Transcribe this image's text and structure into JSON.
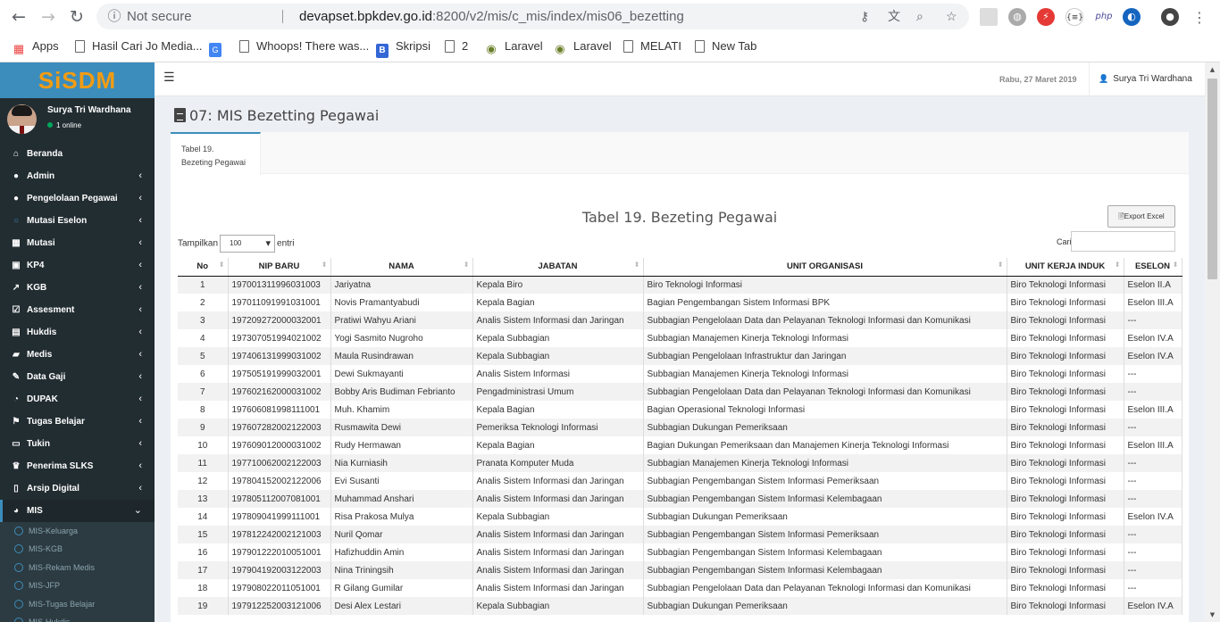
{
  "browser": {
    "security_label": "Not secure",
    "url_host": "devapset.bpkdev.go.id",
    "url_rest": ":8200/v2/mis/c_mis/index/mis06_bezetting",
    "bookmarks": [
      {
        "label": "Apps",
        "icon": "apps-grid-icon"
      },
      {
        "label": "Hasil Cari Jo Media...",
        "icon": "page-icon"
      },
      {
        "label": "",
        "icon": "translate-icon"
      },
      {
        "label": "Whoops! There was...",
        "icon": "page-icon"
      },
      {
        "label": "Skripsi",
        "icon": "b-blue-icon"
      },
      {
        "label": "2",
        "icon": "page-icon"
      },
      {
        "label": "Laravel",
        "icon": "globe-icon"
      },
      {
        "label": "Laravel",
        "icon": "globe-icon"
      },
      {
        "label": "MELATI",
        "icon": "page-icon"
      },
      {
        "label": "New Tab",
        "icon": "page-icon"
      }
    ],
    "ext_php_label": "php"
  },
  "sidebar": {
    "logo": "SiSDM",
    "user_name": "Surya Tri Wardhana",
    "user_status": "1 online",
    "items": [
      {
        "label": "Beranda",
        "icon": "home-icon",
        "chevron": false
      },
      {
        "label": "Admin",
        "icon": "circle-icon",
        "chevron": true
      },
      {
        "label": "Pengelolaan Pegawai",
        "icon": "circle-icon",
        "chevron": true
      },
      {
        "label": "Mutasi Eselon",
        "icon": "circle-outline-icon",
        "chevron": true
      },
      {
        "label": "Mutasi",
        "icon": "grid-icon",
        "chevron": true
      },
      {
        "label": "KP4",
        "icon": "id-card-icon",
        "chevron": true
      },
      {
        "label": "KGB",
        "icon": "line-chart-icon",
        "chevron": true
      },
      {
        "label": "Assesment",
        "icon": "check-square-icon",
        "chevron": true
      },
      {
        "label": "Hukdis",
        "icon": "book-icon",
        "chevron": true
      },
      {
        "label": "Medis",
        "icon": "ambulance-icon",
        "chevron": true
      },
      {
        "label": "Data Gaji",
        "icon": "edit-icon",
        "chevron": true
      },
      {
        "label": "DUPAK",
        "icon": "dashboard-icon",
        "chevron": true
      },
      {
        "label": "Tugas Belajar",
        "icon": "flag-icon",
        "chevron": true
      },
      {
        "label": "Tukin",
        "icon": "money-icon",
        "chevron": true
      },
      {
        "label": "Penerima SLKS",
        "icon": "trophy-icon",
        "chevron": true
      },
      {
        "label": "Arsip Digital",
        "icon": "file-icon",
        "chevron": true
      },
      {
        "label": "MIS",
        "icon": "pie-chart-icon",
        "chevron": true
      }
    ],
    "mis_subitems": [
      "MIS-Keluarga",
      "MIS-KGB",
      "MIS-Rekam Medis",
      "MIS-JFP",
      "MIS-Tugas Belajar",
      "MIS-Hukdis"
    ]
  },
  "topbar": {
    "date": "Rabu, 27 Maret 2019",
    "user": "Surya Tri Wardhana"
  },
  "page": {
    "title": "07: MIS Bezetting Pegawai",
    "tab_line1": "Tabel 19.",
    "tab_line2": "Bezeting Pegawai",
    "table_title": "Tabel 19. Bezeting Pegawai",
    "export_label": "Export Excel",
    "length_prefix": "Tampilkan",
    "length_value": "100",
    "length_suffix": "entri",
    "search_label": "Cari:"
  },
  "table": {
    "columns": [
      "No",
      "NIP BARU",
      "NAMA",
      "JABATAN",
      "UNIT ORGANISASI",
      "UNIT KERJA INDUK",
      "ESELON"
    ],
    "rows": [
      [
        "1",
        "197001311996031003",
        "Jariyatna",
        "Kepala Biro",
        "Biro Teknologi Informasi",
        "Biro Teknologi Informasi",
        "Eselon II.A"
      ],
      [
        "2",
        "197011091991031001",
        "Novis Pramantyabudi",
        "Kepala Bagian",
        "Bagian Pengembangan Sistem Informasi BPK",
        "Biro Teknologi Informasi",
        "Eselon III.A"
      ],
      [
        "3",
        "197209272000032001",
        "Pratiwi Wahyu Ariani",
        "Analis Sistem Informasi dan Jaringan",
        "Subbagian Pengelolaan Data dan Pelayanan Teknologi Informasi dan Komunikasi",
        "Biro Teknologi Informasi",
        "---"
      ],
      [
        "4",
        "197307051994021002",
        "Yogi Sasmito Nugroho",
        "Kepala Subbagian",
        "Subbagian Manajemen Kinerja Teknologi Informasi",
        "Biro Teknologi Informasi",
        "Eselon IV.A"
      ],
      [
        "5",
        "197406131999031002",
        "Maula Rusindrawan",
        "Kepala Subbagian",
        "Subbagian Pengelolaan Infrastruktur dan Jaringan",
        "Biro Teknologi Informasi",
        "Eselon IV.A"
      ],
      [
        "6",
        "197505191999032001",
        "Dewi Sukmayanti",
        "Analis Sistem Informasi",
        "Subbagian Manajemen Kinerja Teknologi Informasi",
        "Biro Teknologi Informasi",
        "---"
      ],
      [
        "7",
        "197602162000031002",
        "Bobby Aris Budiman Febrianto",
        "Pengadministrasi Umum",
        "Subbagian Pengelolaan Data dan Pelayanan Teknologi Informasi dan Komunikasi",
        "Biro Teknologi Informasi",
        "---"
      ],
      [
        "8",
        "197606081998111001",
        "Muh. Khamim",
        "Kepala Bagian",
        "Bagian Operasional Teknologi Informasi",
        "Biro Teknologi Informasi",
        "Eselon III.A"
      ],
      [
        "9",
        "197607282002122003",
        "Rusmawita Dewi",
        "Pemeriksa Teknologi Informasi",
        "Subbagian Dukungan Pemeriksaan",
        "Biro Teknologi Informasi",
        "---"
      ],
      [
        "10",
        "197609012000031002",
        "Rudy Hermawan",
        "Kepala Bagian",
        "Bagian Dukungan Pemeriksaan dan Manajemen Kinerja Teknologi Informasi",
        "Biro Teknologi Informasi",
        "Eselon III.A"
      ],
      [
        "11",
        "197710062002122003",
        "Nia Kurniasih",
        "Pranata Komputer Muda",
        "Subbagian Manajemen Kinerja Teknologi Informasi",
        "Biro Teknologi Informasi",
        "---"
      ],
      [
        "12",
        "197804152002122006",
        "Evi Susanti",
        "Analis Sistem Informasi dan Jaringan",
        "Subbagian Pengembangan Sistem Informasi Pemeriksaan",
        "Biro Teknologi Informasi",
        "---"
      ],
      [
        "13",
        "197805112007081001",
        "Muhammad Anshari",
        "Analis Sistem Informasi dan Jaringan",
        "Subbagian Pengembangan Sistem Informasi Kelembagaan",
        "Biro Teknologi Informasi",
        "---"
      ],
      [
        "14",
        "197809041999111001",
        "Risa Prakosa Mulya",
        "Kepala Subbagian",
        "Subbagian Dukungan Pemeriksaan",
        "Biro Teknologi Informasi",
        "Eselon IV.A"
      ],
      [
        "15",
        "197812242002121003",
        "Nuril Qomar",
        "Analis Sistem Informasi dan Jaringan",
        "Subbagian Pengembangan Sistem Informasi Pemeriksaan",
        "Biro Teknologi Informasi",
        "---"
      ],
      [
        "16",
        "197901222010051001",
        "Hafizhuddin Amin",
        "Analis Sistem Informasi dan Jaringan",
        "Subbagian Pengembangan Sistem Informasi Kelembagaan",
        "Biro Teknologi Informasi",
        "---"
      ],
      [
        "17",
        "197904192003122003",
        "Nina Triningsih",
        "Analis Sistem Informasi dan Jaringan",
        "Subbagian Pengembangan Sistem Informasi Kelembagaan",
        "Biro Teknologi Informasi",
        "---"
      ],
      [
        "18",
        "197908022011051001",
        "R Gilang Gumilar",
        "Analis Sistem Informasi dan Jaringan",
        "Subbagian Pengelolaan Data dan Pelayanan Teknologi Informasi dan Komunikasi",
        "Biro Teknologi Informasi",
        "---"
      ],
      [
        "19",
        "197912252003121006",
        "Desi Alex Lestari",
        "Kepala Subbagian",
        "Subbagian Dukungan Pemeriksaan",
        "Biro Teknologi Informasi",
        "Eselon IV.A"
      ]
    ]
  }
}
